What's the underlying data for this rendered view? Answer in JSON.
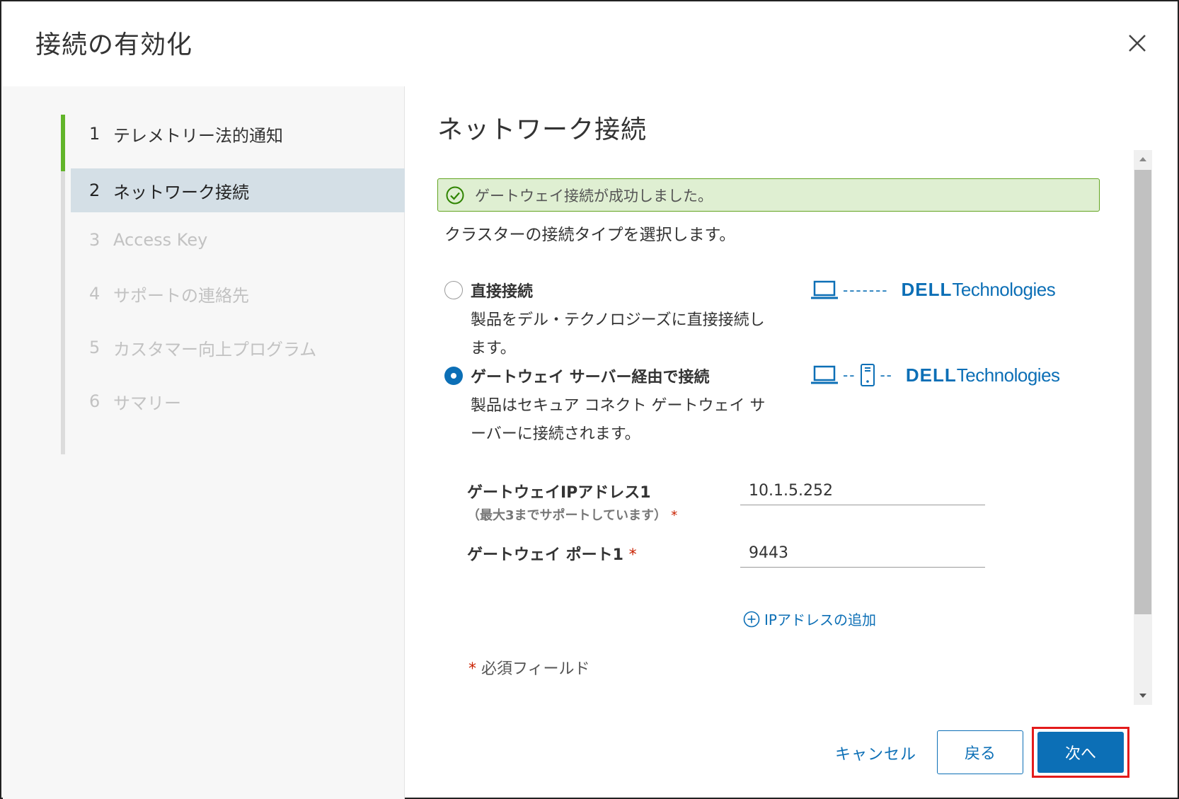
{
  "dialog": {
    "title": "接続の有効化"
  },
  "stepper": {
    "steps": [
      {
        "num": "1",
        "label": "テレメトリー法的通知",
        "state": "done"
      },
      {
        "num": "2",
        "label": "ネットワーク接続",
        "state": "active"
      },
      {
        "num": "3",
        "label": "Access Key",
        "state": "pending"
      },
      {
        "num": "4",
        "label": "サポートの連絡先",
        "state": "pending"
      },
      {
        "num": "5",
        "label": "カスタマー向上プログラム",
        "state": "pending"
      },
      {
        "num": "6",
        "label": "サマリー",
        "state": "pending"
      }
    ]
  },
  "content": {
    "title": "ネットワーク接続",
    "alert": "ゲートウェイ接続が成功しました。",
    "intro": "クラスターの接続タイプを選択します。",
    "options": [
      {
        "label": "直接接続",
        "description": "製品をデル・テクノロジーズに直接接続します。",
        "checked": false,
        "diagram_dashes": "-------"
      },
      {
        "label": "ゲートウェイ サーバー経由で接続",
        "description": "製品はセキュア コネクト ゲートウェイ サーバーに接続されます。",
        "checked": true,
        "diagram_dashes": "--"
      }
    ],
    "logo": {
      "dell": "DELL",
      "tech": "Technologies"
    },
    "form": {
      "ip_label": "ゲートウェイIPアドレス1",
      "ip_sublabel": "（最大3までサポートしています）",
      "ip_value": "10.1.5.252",
      "port_label": "ゲートウェイ ポート1",
      "port_value": "9443",
      "required_mark": "*",
      "add_ip": "IPアドレスの追加",
      "required_note": "必須フィールド"
    }
  },
  "footer": {
    "cancel": "キャンセル",
    "back": "戻る",
    "next": "次へ"
  },
  "colors": {
    "accent": "#0c6fb6",
    "success": "#62a420",
    "required": "#c92100",
    "highlight": "#e31b1b"
  }
}
